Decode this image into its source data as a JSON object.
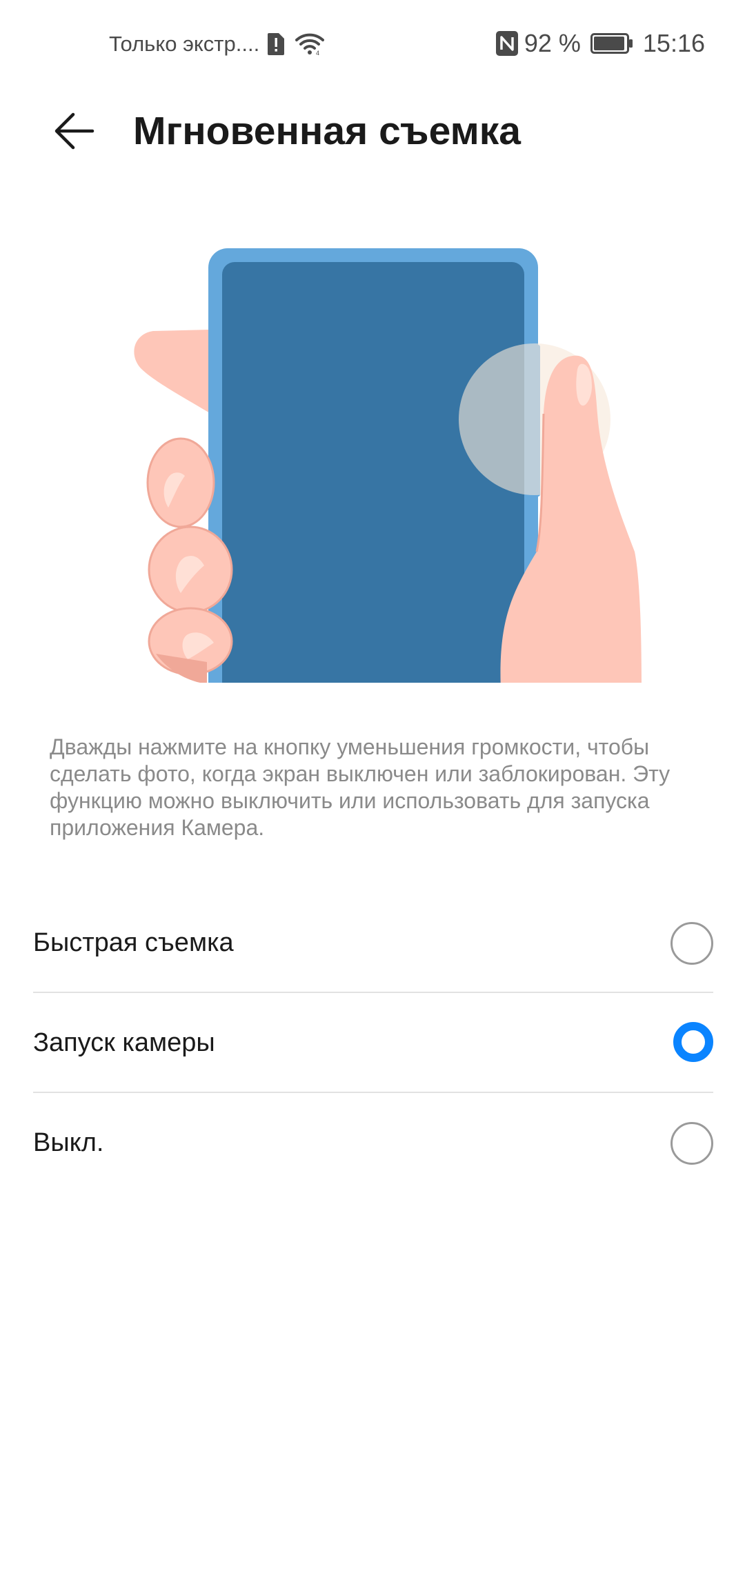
{
  "status_bar": {
    "carrier_text": "Только экстр....",
    "battery_percent": "92 %",
    "time": "15:16",
    "icons": [
      "sim-alert-icon",
      "wifi-icon",
      "nfc-icon",
      "battery-icon"
    ]
  },
  "header": {
    "title": "Мгновенная съемка",
    "back_icon": "arrow-left-icon"
  },
  "illustration": {
    "subject": "hand-holding-phone-illustration",
    "colors": {
      "phone_frame": "#64a8dc",
      "phone_screen": "#3775a4",
      "skin": "#fec6b8",
      "skin_shadow": "#f0a898",
      "touch_highlight": "#f7e8d8"
    }
  },
  "description": "Дважды нажмите на кнопку уменьшения громкости, чтобы сделать фото, когда экран выключен или заблокирован. Эту функцию можно выключить или использовать для запуска приложения Камера.",
  "options": [
    {
      "label": "Быстрая съемка",
      "selected": false
    },
    {
      "label": "Запуск камеры",
      "selected": true
    },
    {
      "label": "Выкл.",
      "selected": false
    }
  ],
  "colors": {
    "accent": "#0a84ff",
    "text_primary": "#1a1a1a",
    "text_secondary": "#8a8a8a",
    "divider": "#e2e2e2"
  }
}
